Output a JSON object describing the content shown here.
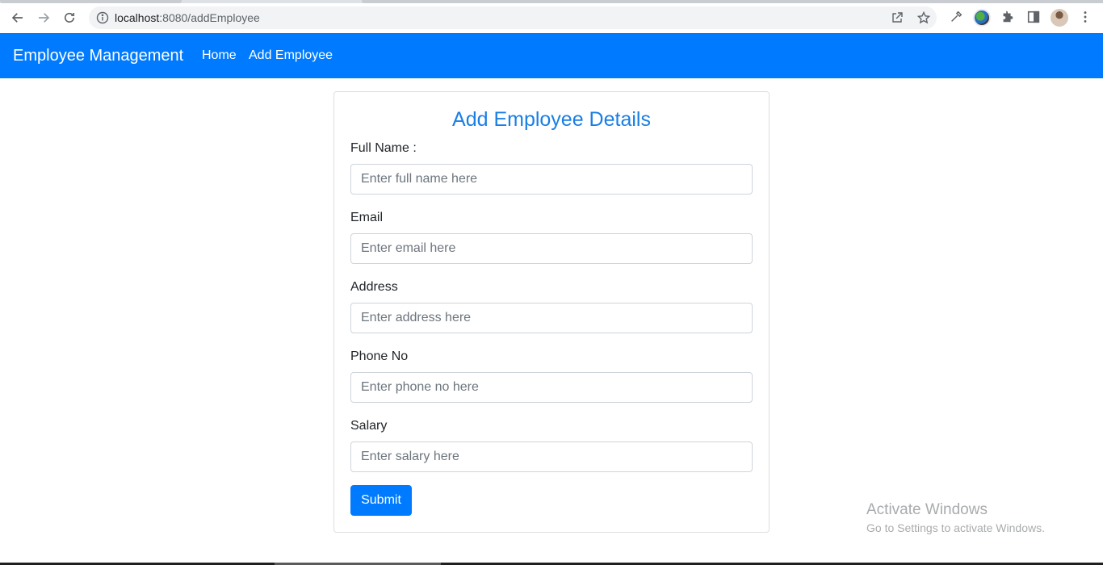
{
  "browser": {
    "url_host": "localhost",
    "url_path": ":8080/addEmployee",
    "icons": {
      "back": "back-arrow-icon",
      "forward": "forward-arrow-icon",
      "reload": "reload-icon",
      "info": "info-icon",
      "share": "share-icon",
      "bookmark": "star-icon",
      "eyedropper": "eyedropper-icon",
      "extension": "globe-extension-icon",
      "extensions": "puzzle-icon",
      "sidepanel": "side-panel-icon",
      "profile": "avatar",
      "menu": "kebab-menu-icon"
    }
  },
  "navbar": {
    "brand": "Employee Management",
    "links": [
      "Home",
      "Add Employee"
    ],
    "color": "#007bff"
  },
  "form": {
    "title": "Add Employee Details",
    "fields": [
      {
        "label": "Full Name :",
        "value": "",
        "placeholder": "Enter full name here"
      },
      {
        "label": "Email",
        "value": "",
        "placeholder": "Enter email here"
      },
      {
        "label": "Address",
        "value": "",
        "placeholder": "Enter address here"
      },
      {
        "label": "Phone No",
        "value": "",
        "placeholder": "Enter phone no here"
      },
      {
        "label": "Salary",
        "value": "",
        "placeholder": "Enter salary here"
      }
    ],
    "submit_label": "Submit"
  },
  "watermark": {
    "title": "Activate Windows",
    "subtitle": "Go to Settings to activate Windows."
  }
}
